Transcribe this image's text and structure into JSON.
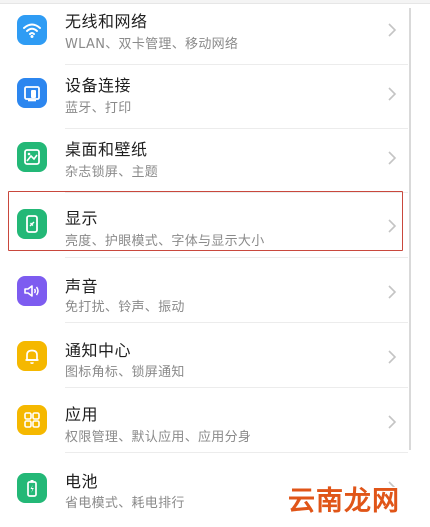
{
  "colors": {
    "wifi": "#2f9cf4",
    "devices": "#2c86ef",
    "wallpaper": "#23b877",
    "display": "#23b877",
    "sound": "#7d5cf0",
    "notifications": "#f5b800",
    "apps": "#f5b800",
    "battery": "#23b877",
    "highlight_border": "#c9483d",
    "watermark": "#e05518"
  },
  "settings": {
    "items": [
      {
        "icon": "wifi-icon",
        "title": "无线和网络",
        "subtitle": "WLAN、双卡管理、移动网络"
      },
      {
        "icon": "device-connect-icon",
        "title": "设备连接",
        "subtitle": "蓝牙、打印"
      },
      {
        "icon": "wallpaper-icon",
        "title": "桌面和壁纸",
        "subtitle": "杂志锁屏、主题"
      },
      {
        "icon": "display-icon",
        "title": "显示",
        "subtitle": "亮度、护眼模式、字体与显示大小"
      },
      {
        "icon": "speaker-icon",
        "title": "声音",
        "subtitle": "免打扰、铃声、振动"
      },
      {
        "icon": "bell-icon",
        "title": "通知中心",
        "subtitle": "图标角标、锁屏通知"
      },
      {
        "icon": "apps-grid-icon",
        "title": "应用",
        "subtitle": "权限管理、默认应用、应用分身"
      },
      {
        "icon": "battery-icon",
        "title": "电池",
        "subtitle": "省电模式、耗电排行"
      }
    ]
  },
  "watermark": "云南龙网"
}
